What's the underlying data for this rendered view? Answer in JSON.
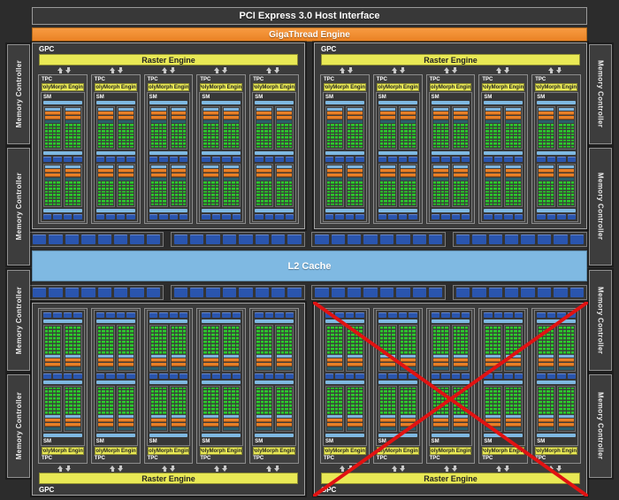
{
  "header": {
    "pci_label": "PCI Express 3.0 Host Interface",
    "gigathread_label": "GigaThread Engine"
  },
  "labels": {
    "gpc": "GPC",
    "tpc": "TPC",
    "sm": "SM",
    "raster_engine": "Raster Engine",
    "polymorph_engine": "PolyMorph Engine",
    "l2_cache": "L2 Cache",
    "memory_controller": "Memory Controller"
  },
  "structure": {
    "gpc_count": 4,
    "tpcs_per_gpc": 5,
    "sms_per_tpc": 1,
    "core_blocks_per_sm": 4,
    "core_grid": {
      "cols": 4,
      "rows": 8
    },
    "tex_chips_per_row": 4,
    "memory_controller_count": 8,
    "mem_chip_groups_per_row": 4,
    "mem_chip_rows": 2,
    "chips_per_group": 8,
    "disabled_gpc": {
      "position": "bottom-right",
      "marker": "red-x"
    }
  },
  "colors": {
    "background": "#2c2c2c",
    "panel": "#3b3b3b",
    "yellow_engine": "#e9e955",
    "orange_header": "#ef8a2d",
    "light_blue": "#7fb9e2",
    "core_green": "#2ec82e",
    "chip_blue": "#2a55ae",
    "orange_row": "#e87f26",
    "teal_row": "#2a5f6b",
    "disabled_x_red": "#e11212"
  }
}
